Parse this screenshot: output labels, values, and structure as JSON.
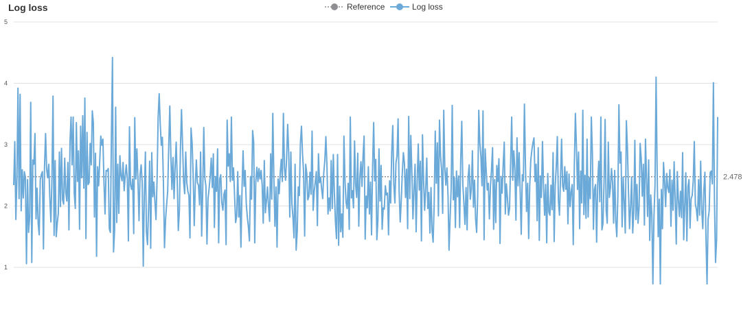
{
  "chart_data": {
    "type": "line",
    "title": "Log loss",
    "xlabel": "",
    "ylabel": "",
    "ylim": [
      0.5,
      5
    ],
    "yticks": [
      1,
      2,
      3,
      4,
      5
    ],
    "grid": true,
    "legend": {
      "position": "top-center"
    },
    "reference": {
      "name": "Reference",
      "value": 2.478,
      "label": "2.478",
      "color": "#8e8e93",
      "style": "dotted"
    },
    "series": [
      {
        "name": "Log loss",
        "color": "#6aa9d8",
        "values": [
          2.34,
          3.05,
          1.78,
          2.46,
          3.92,
          2.12,
          3.82,
          1.92,
          2.59,
          2.13,
          2.56,
          2.46,
          1.06,
          2.43,
          1.57,
          1.82,
          3.69,
          1.08,
          2.75,
          2.68,
          3.18,
          1.79,
          2.29,
          1.72,
          1.53,
          2.43,
          2.51,
          2.56,
          1.3,
          2.64,
          3.18,
          2.6,
          2.46,
          2.68,
          2.13,
          1.74,
          2.47,
          3.79,
          1.52,
          2.74,
          1.5,
          1.72,
          1.88,
          2.88,
          1.99,
          2.94,
          2.1,
          2.03,
          2.78,
          2.22,
          2.08,
          2.71,
          1.61,
          3.05,
          3.45,
          2.67,
          3.45,
          2.2,
          1.96,
          3.36,
          2.4,
          2.9,
          1.62,
          3.3,
          2.46,
          3.47,
          2.29,
          3.76,
          1.47,
          3.2,
          2.35,
          2.38,
          3.02,
          2.67,
          3.55,
          3.36,
          1.82,
          2.86,
          1.18,
          2.64,
          2.33,
          2.74,
          3.14,
          2.99,
          3.09,
          2.38,
          1.87,
          2.58,
          2.57,
          2.61,
          1.63,
          1.57,
          3.13,
          4.42,
          1.25,
          1.6,
          3.61,
          1.73,
          2.68,
          1.88,
          2.82,
          2.49,
          2.41,
          2.71,
          2.25,
          2.49,
          2.67,
          2.44,
          1.43,
          3.29,
          2.34,
          2.27,
          2.44,
          1.55,
          3.44,
          2.44,
          2.93,
          2.42,
          1.76,
          2.51,
          2.67,
          2.38,
          1.02,
          2.18,
          2.88,
          1.57,
          1.37,
          1.96,
          2.73,
          1.31,
          2.87,
          2.15,
          2.39,
          2.06,
          1.78,
          2.44,
          3.44,
          3.83,
          3.33,
          2.99,
          3.12,
          2.36,
          1.32,
          1.78,
          2.02,
          2.24,
          2.98,
          3.63,
          2.82,
          2.27,
          2.79,
          2.12,
          2.63,
          3.04,
          2.44,
          1.6,
          1.92,
          2.92,
          3.57,
          3.01,
          2.4,
          2.2,
          2.88,
          2.38,
          2.24,
          2.17,
          1.48,
          3.27,
          3.03,
          2.51,
          1.68,
          2.33,
          2.75,
          2.38,
          2.34,
          2.02,
          2.88,
          1.51,
          2.24,
          3.28,
          2.46,
          2.32,
          1.38,
          2.12,
          2.28,
          2.47,
          2.78,
          2.3,
          2.85,
          1.65,
          2.48,
          2.24,
          2.93,
          1.4,
          2.44,
          2.51,
          2.05,
          1.93,
          2.19,
          2.26,
          1.37,
          3.4,
          2.65,
          2.85,
          2.4,
          3.45,
          2.42,
          2.62,
          2.17,
          1.73,
          1.84,
          2.56,
          1.82,
          2.17,
          1.33,
          2.27,
          2.9,
          2.32,
          2.58,
          2.04,
          1.82,
          1.66,
          1.43,
          2.48,
          2.11,
          3.23,
          3.04,
          1.4,
          2.4,
          2.63,
          2.4,
          2.61,
          2.44,
          2.58,
          2.34,
          1.72,
          2.74,
          1.89,
          2.08,
          2.31,
          1.99,
          1.75,
          2.85,
          2.11,
          3.51,
          2.46,
          1.67,
          2.31,
          1.33,
          2.44,
          2.2,
          2.54,
          2.76,
          2.4,
          3.51,
          2.62,
          2.42,
          2.78,
          3.33,
          2.86,
          1.82,
          2.88,
          2.04,
          1.81,
          1.48,
          2.68,
          1.28,
          1.58,
          2.31,
          2.17,
          3.02,
          3.3,
          2.85,
          2.55,
          1.51,
          2.68,
          2.53,
          2.1,
          2.16,
          2.55,
          2.19,
          3.22,
          1.93,
          2.24,
          2.39,
          2.56,
          1.68,
          2.85,
          2.38,
          2.47,
          2.28,
          2.12,
          2.54,
          2.74,
          3.13,
          2.66,
          1.87,
          2.13,
          1.92,
          2.74,
          1.96,
          2.84,
          2.21,
          1.74,
          1.47,
          2.84,
          1.36,
          2.32,
          1.58,
          1.87,
          1.49,
          3.14,
          2.41,
          2.06,
          1.96,
          2.37,
          1.62,
          3.45,
          2.13,
          2.25,
          1.97,
          3.06,
          2.35,
          2.14,
          2.86,
          1.67,
          2.47,
          2.72,
          2.32,
          2.81,
          3.14,
          1.46,
          2.16,
          1.97,
          2.64,
          1.87,
          2.39,
          1.53,
          2.64,
          3.36,
          2.41,
          2.76,
          1.45,
          1.77,
          2.93,
          2.08,
          2.66,
          1.62,
          1.97,
          1.95,
          2.33,
          2.18,
          2.21,
          1.53,
          2.41,
          2.05,
          2.87,
          3.31,
          2.35,
          2.05,
          2.7,
          2.82,
          3.42,
          2.23,
          1.74,
          2.09,
          2.55,
          2.87,
          2.69,
          2.14,
          2.6,
          1.63,
          3.46,
          2.12,
          3.15,
          2.54,
          1.79,
          2.26,
          2.68,
          1.58,
          2.39,
          3.01,
          2.26,
          2.73,
          1.43,
          3.16,
          2.43,
          1.93,
          2.27,
          2.78,
          1.96,
          2.22,
          1.56,
          2.3,
          1.6,
          1.41,
          2.03,
          3.22,
          2.37,
          3.03,
          1.84,
          3.4,
          2.82,
          2.58,
          1.88,
          3.56,
          2.62,
          2.34,
          2.62,
          2.19,
          1.28,
          1.81,
          2.28,
          3.64,
          2.1,
          2.46,
          1.65,
          2.57,
          2.15,
          2.49,
          1.65,
          2.76,
          3.38,
          2.35,
          2.04,
          1.7,
          2.3,
          1.61,
          2.47,
          2.67,
          2.11,
          2.27,
          2.9,
          1.98,
          2.42,
          1.79,
          1.57,
          2.17,
          3.56,
          3.03,
          2.81,
          2.33,
          3.55,
          1.45,
          2.93,
          2.57,
          2.26,
          2.37,
          1.79,
          2.32,
          2.59,
          2.95,
          1.62,
          2.43,
          1.73,
          2.66,
          2.4,
          2.77,
          1.39,
          2.48,
          2.21,
          2.67,
          3.04,
          1.87,
          2.36,
          2.13,
          1.85,
          1.96,
          2.71,
          3.45,
          2.42,
          2.9,
          2.6,
          1.77,
          3.11,
          2.33,
          2.87,
          2.24,
          1.54,
          2.51,
          2.41,
          3.66,
          2.64,
          1.91,
          2.37,
          1.47,
          2.33,
          2.75,
          2.91,
          3.03,
          3.11,
          2.4,
          2.68,
          1.76,
          2.95,
          1.44,
          2.49,
          2.14,
          3.05,
          2.32,
          1.85,
          2.35,
          1.4,
          2.53,
          1.9,
          1.85,
          2.34,
          1.94,
          2.87,
          1.42,
          2.33,
          2.65,
          3.13,
          2.09,
          1.85,
          2.46,
          3.09,
          2.33,
          2.24,
          2.64,
          2.27,
          2.56,
          1.71,
          2.52,
          1.99,
          2.23,
          2.35,
          1.37,
          2.65,
          3.51,
          2.96,
          2.27,
          2.88,
          1.63,
          2.57,
          2.05,
          3.56,
          1.86,
          2.5,
          1.8,
          3.09,
          1.82,
          2.46,
          2.12,
          3.45,
          2.87,
          1.62,
          2.27,
          2.35,
          1.41,
          2.37,
          2.73,
          2.07,
          3.45,
          1.61,
          1.72,
          2.41,
          3.41,
          1.92,
          1.72,
          3.04,
          2.14,
          2.29,
          2.61,
          2.38,
          1.72,
          2.58,
          1.76,
          1.5,
          2.16,
          3.65,
          2.7,
          2.88,
          1.66,
          2.47,
          2.05,
          1.56,
          3.39,
          2.96,
          2.24,
          1.63,
          1.98,
          2.47,
          1.56,
          1.92,
          3.07,
          1.78,
          2.35,
          1.72,
          1.98,
          3.02,
          2.77,
          2.16,
          2.68,
          1.69,
          3.09,
          2.45,
          1.83,
          2.75,
          1.44,
          2.18,
          1.86,
          0.73,
          1.83,
          2.34,
          4.1,
          2.56,
          1.5,
          2.11,
          0.73,
          2.27,
          1.63,
          2.71,
          2.42,
          1.99,
          2.53,
          2.3,
          2.22,
          2.59,
          1.67,
          2.42,
          1.93,
          2.72,
          2.1,
          1.38,
          2.56,
          2.1,
          1.83,
          2.24,
          1.81,
          2.87,
          1.45,
          2.0,
          2.54,
          1.43,
          2.31,
          2.43,
          1.64,
          2.12,
          2.17,
          2.41,
          3.05,
          2.03,
          1.94,
          1.76,
          2.43,
          1.85,
          2.73,
          1.94,
          1.63,
          2.26,
          2.55,
          1.48,
          0.73,
          1.78,
          1.92,
          2.55,
          2.57,
          2.36,
          4.01,
          2.09,
          1.08,
          1.45,
          3.45
        ]
      }
    ]
  }
}
